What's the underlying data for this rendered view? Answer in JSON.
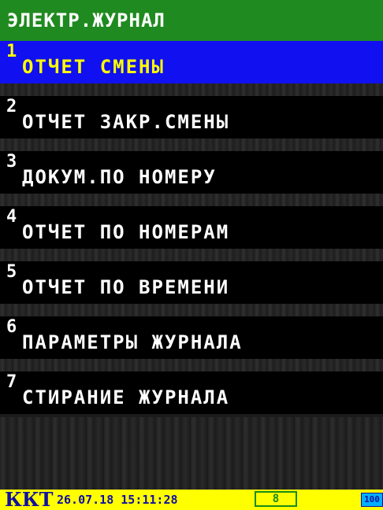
{
  "header": {
    "title": "ЭЛЕКТР.ЖУРНАЛ"
  },
  "menu": {
    "selected_index": 0,
    "items": [
      {
        "number": "1",
        "label": "ОТЧЕТ СМЕНЫ"
      },
      {
        "number": "2",
        "label": "ОТЧЕТ ЗАКР.СМЕНЫ"
      },
      {
        "number": "3",
        "label": "ДОКУМ.ПО НОМЕРУ"
      },
      {
        "number": "4",
        "label": "ОТЧЕТ ПО НОМЕРАМ"
      },
      {
        "number": "5",
        "label": "ОТЧЕТ ПО ВРЕМЕНИ"
      },
      {
        "number": "6",
        "label": "ПАРАМЕТРЫ ЖУРНАЛА"
      },
      {
        "number": "7",
        "label": "СТИРАНИЕ ЖУРНАЛА"
      }
    ]
  },
  "status": {
    "device": "ККТ",
    "datetime": "26.07.18 15:11:28",
    "counter": "8",
    "battery": "100"
  },
  "colors": {
    "header_bg": "#1f8a1f",
    "selected_bg": "#1010f0",
    "selected_fg": "#ffff00",
    "item_bg": "#000000",
    "item_fg": "#ffffff",
    "status_bg": "#ffff00",
    "status_fg": "#1010a0",
    "counter_border": "#1a8a1a",
    "battery_bg": "#00b0ff"
  }
}
